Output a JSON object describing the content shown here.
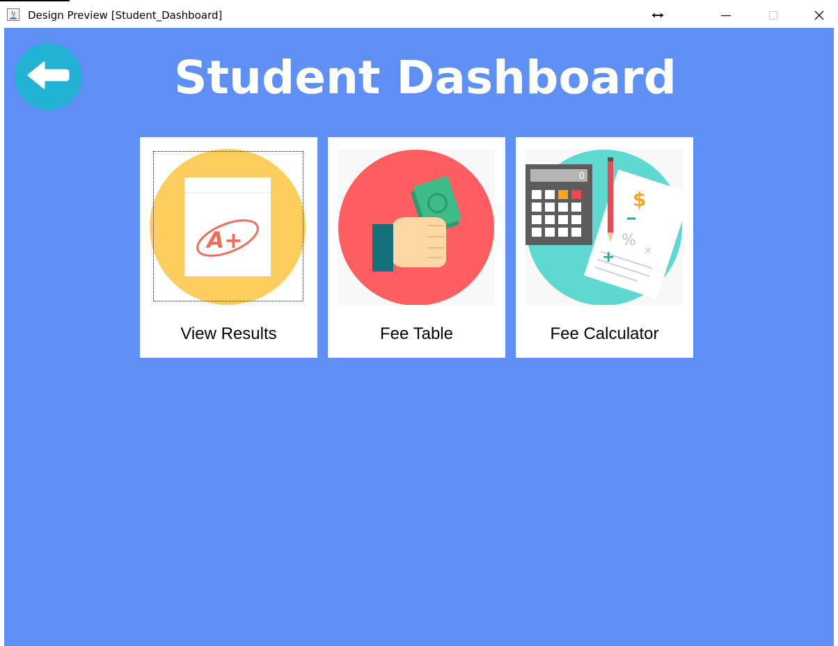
{
  "window": {
    "title": "Design Preview [Student_Dashboard]",
    "icons": [
      "java-app-icon",
      "resize-arrows-icon",
      "minimize-icon",
      "maximize-icon",
      "close-icon"
    ]
  },
  "header": {
    "title": "Student Dashboard",
    "back_icon": "arrow-left-icon"
  },
  "cards": [
    {
      "label": "View Results",
      "icon": "grade-sheet-icon",
      "image_text": "A+"
    },
    {
      "label": "Fee Table",
      "icon": "hand-money-icon"
    },
    {
      "label": "Fee Calculator",
      "icon": "calculator-icon",
      "image_text": "0"
    }
  ],
  "colors": {
    "background": "#5e8ff4",
    "back_button": "#22b3d4",
    "results_circle": "#fdcd5e",
    "fee_circle": "#fe5e62",
    "calc_circle": "#5dd9cf",
    "text_light": "#ffffff"
  }
}
